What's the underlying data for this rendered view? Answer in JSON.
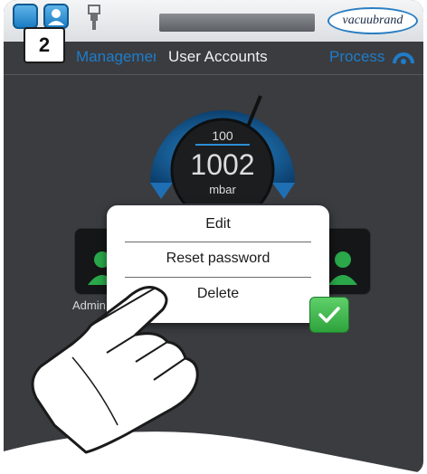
{
  "step": {
    "number": "2"
  },
  "header": {
    "logo_text": "vacuubrand"
  },
  "tabs": {
    "left": "Management",
    "center": "User Accounts",
    "right": "Process"
  },
  "gauge": {
    "setpoint": "100",
    "value": "1002",
    "unit": "mbar"
  },
  "users": [
    {
      "name": "Admin"
    }
  ],
  "context_menu": {
    "items": [
      {
        "label": "Edit"
      },
      {
        "label": "Reset password"
      },
      {
        "label": "Delete"
      }
    ]
  },
  "colors": {
    "accent": "#1f7cc8",
    "confirm": "#3bb54a",
    "background": "#3a3c40"
  }
}
